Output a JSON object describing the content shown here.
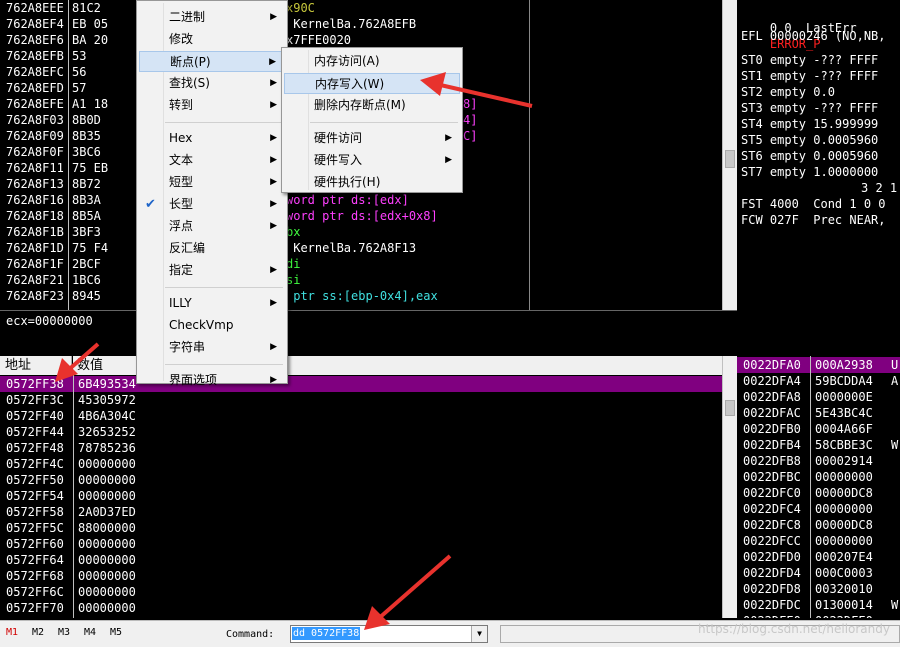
{
  "disasm": {
    "rows": [
      {
        "addr": "762A8EEE",
        "hex": "81C2",
        "code": "x90C",
        "color": "#c8c83c"
      },
      {
        "addr": "762A8EF4",
        "hex": "EB 05",
        "code": " KernelBa.762A8EFB",
        "color": "#ffffff"
      },
      {
        "addr": "762A8EF6",
        "hex": "BA 20",
        "code": "x7FFE0020",
        "color": "#ffffff"
      },
      {
        "addr": "762A8EFB",
        "hex": "53",
        "code": "",
        "color": "#ffffff"
      },
      {
        "addr": "762A8EFC",
        "hex": "56",
        "code": "",
        "color": "#ffffff"
      },
      {
        "addr": "762A8EFD",
        "hex": "57",
        "code": "",
        "color": "#ffffff"
      },
      {
        "addr": "762A8EFE",
        "hex": "A1 18",
        "code": "",
        "color": "#ffffff"
      },
      {
        "addr": "762A8F03",
        "hex": "8B0D",
        "code": "",
        "color": "#ffffff"
      },
      {
        "addr": "762A8F09",
        "hex": "8B35",
        "code": "",
        "color": "#ffffff"
      },
      {
        "addr": "762A8F0F",
        "hex": "3BC6",
        "code": "",
        "color": "#ffffff"
      },
      {
        "addr": "762A8F11",
        "hex": "75 EB",
        "code": "",
        "color": "#ffffff"
      },
      {
        "addr": "762A8F13",
        "hex": "8B72",
        "code": "",
        "color": "#ffffff"
      },
      {
        "addr": "762A8F16",
        "hex": "8B3A",
        "code": "word ptr ds:[edx]",
        "color": "#ff40ff"
      },
      {
        "addr": "762A8F18",
        "hex": "8B5A",
        "code": "word ptr ds:[edx+0x8]",
        "color": "#ff40ff"
      },
      {
        "addr": "762A8F1B",
        "hex": "3BF3",
        "code": "bx",
        "color": "#40ff40"
      },
      {
        "addr": "762A8F1D",
        "hex": "75 F4",
        "code": " KernelBa.762A8F13",
        "color": "#ffffff"
      },
      {
        "addr": "762A8F1F",
        "hex": "2BCF",
        "code": "di",
        "color": "#40ff40"
      },
      {
        "addr": "762A8F21",
        "hex": "1BC6",
        "code": "si",
        "color": "#40ff40"
      },
      {
        "addr": "762A8F23",
        "hex": "8945",
        "code": " ptr ss:[ebp-0x4],eax",
        "color": "#40e0e0"
      }
    ],
    "right_fragments": [
      "8]",
      "4]",
      "C]"
    ]
  },
  "registers": {
    "lasterr_label": "0 0  LastErr",
    "lasterr_value": "ERROR_P",
    "efl": "EFL 00000246 (NO,NB,",
    "fpu": [
      "ST0 empty -??? FFFF",
      "ST1 empty -??? FFFF",
      "ST2 empty 0.0",
      "ST3 empty -??? FFFF",
      "ST4 empty 15.999999",
      "ST5 empty 0.0005960",
      "ST6 empty 0.0005960",
      "ST7 empty 1.0000000"
    ],
    "bits": "3 2 1",
    "fst": "FST 4000  Cond 1 0 0",
    "fcw": "FCW 027F  Prec NEAR,"
  },
  "info_line": "ecx=00000000",
  "dump": {
    "header_addr": "地址",
    "header_value": "数值",
    "rows": [
      {
        "addr": "0572FF38",
        "val": "6B493534",
        "selected": true
      },
      {
        "addr": "0572FF3C",
        "val": "45305972"
      },
      {
        "addr": "0572FF40",
        "val": "4B6A304C"
      },
      {
        "addr": "0572FF44",
        "val": "32653252"
      },
      {
        "addr": "0572FF48",
        "val": "78785236"
      },
      {
        "addr": "0572FF4C",
        "val": "00000000"
      },
      {
        "addr": "0572FF50",
        "val": "00000000"
      },
      {
        "addr": "0572FF54",
        "val": "00000000"
      },
      {
        "addr": "0572FF58",
        "val": "2A0D37ED"
      },
      {
        "addr": "0572FF5C",
        "val": "88000000"
      },
      {
        "addr": "0572FF60",
        "val": "00000000"
      },
      {
        "addr": "0572FF64",
        "val": "00000000"
      },
      {
        "addr": "0572FF68",
        "val": "00000000"
      },
      {
        "addr": "0572FF6C",
        "val": "00000000"
      },
      {
        "addr": "0572FF70",
        "val": "00000000"
      }
    ]
  },
  "stack": {
    "rows": [
      {
        "addr": "0022DFA0",
        "val": "000A2938",
        "tail": "U",
        "selected": true
      },
      {
        "addr": "0022DFA4",
        "val": "59BCDDA4",
        "tail": "A"
      },
      {
        "addr": "0022DFA8",
        "val": "0000000E",
        "tail": ""
      },
      {
        "addr": "0022DFAC",
        "val": "5E43BC4C",
        "tail": ""
      },
      {
        "addr": "0022DFB0",
        "val": "0004A66F",
        "tail": ""
      },
      {
        "addr": "0022DFB4",
        "val": "58CBBE3C",
        "tail": "W"
      },
      {
        "addr": "0022DFB8",
        "val": "00002914",
        "tail": ""
      },
      {
        "addr": "0022DFBC",
        "val": "00000000",
        "tail": ""
      },
      {
        "addr": "0022DFC0",
        "val": "00000DC8",
        "tail": ""
      },
      {
        "addr": "0022DFC4",
        "val": "00000000",
        "tail": ""
      },
      {
        "addr": "0022DFC8",
        "val": "00000DC8",
        "tail": ""
      },
      {
        "addr": "0022DFCC",
        "val": "00000000",
        "tail": ""
      },
      {
        "addr": "0022DFD0",
        "val": "000207E4",
        "tail": ""
      },
      {
        "addr": "0022DFD4",
        "val": "000C0003",
        "tail": ""
      },
      {
        "addr": "0022DFD8",
        "val": "00320010",
        "tail": ""
      },
      {
        "addr": "0022DFDC",
        "val": "01300014",
        "tail": "W"
      },
      {
        "addr": "0022DFE0",
        "val": "0022DFE0",
        "tail": ""
      }
    ]
  },
  "bottom": {
    "tabs": [
      "M1",
      "M2",
      "M3",
      "M4",
      "M5"
    ],
    "command_label": "Command:",
    "command_value": "dd 0572FF38",
    "watermark": "https://blog.csdn.net/hellorandy"
  },
  "context_menu": {
    "items": [
      {
        "label": "二进制",
        "submenu": true
      },
      {
        "label": "修改",
        "submenu": false
      },
      {
        "label": "断点(P)",
        "submenu": true,
        "highlight": true
      },
      {
        "label": "查找(S)",
        "submenu": true
      },
      {
        "label": "转到",
        "submenu": true
      },
      {
        "sep": true
      },
      {
        "label": "Hex",
        "submenu": true
      },
      {
        "label": "文本",
        "submenu": true
      },
      {
        "label": "短型",
        "submenu": true
      },
      {
        "label": "长型",
        "submenu": true,
        "checked": true
      },
      {
        "label": "浮点",
        "submenu": true
      },
      {
        "label": "反汇编",
        "submenu": false
      },
      {
        "label": "指定",
        "submenu": true
      },
      {
        "sep": true
      },
      {
        "label": "ILLY",
        "submenu": true
      },
      {
        "label": "CheckVmp",
        "submenu": false
      },
      {
        "label": "字符串",
        "submenu": true
      },
      {
        "sep": true
      },
      {
        "label": "界面选项",
        "submenu": true
      }
    ],
    "check_glyph": "✔",
    "arrow_glyph": "▶"
  },
  "submenu": {
    "items": [
      {
        "label": "内存访问(A)",
        "submenu": false
      },
      {
        "label": "内存写入(W)",
        "submenu": false,
        "highlight": true
      },
      {
        "label": "删除内存断点(M)",
        "submenu": false
      },
      {
        "sep": true
      },
      {
        "label": "硬件访问",
        "submenu": true
      },
      {
        "label": "硬件写入",
        "submenu": true
      },
      {
        "label": "硬件执行(H)",
        "submenu": false
      }
    ]
  },
  "colors": {
    "selection": "#800080",
    "arrow": "#e8322d",
    "error": "#ff2020",
    "menu_highlight": "#d5e4f5"
  }
}
